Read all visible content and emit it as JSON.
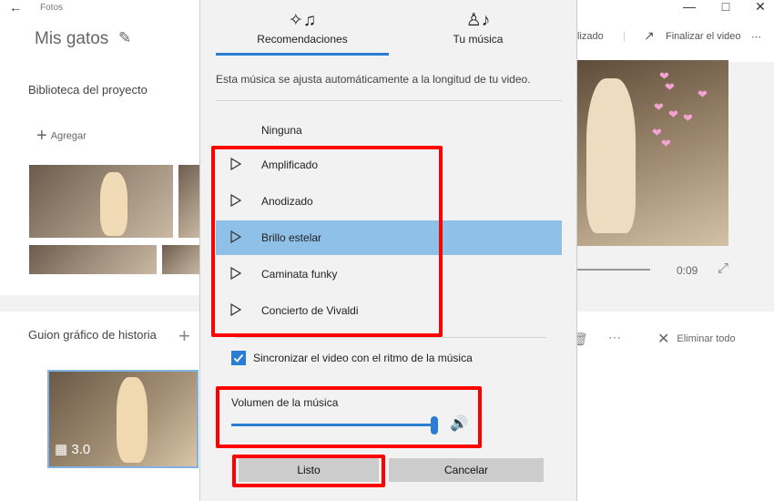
{
  "app": {
    "name": "Fotos",
    "project_title": "Mis gatos",
    "header_buttons": {
      "partial_label": "lizado",
      "finish_label": "Finalizar el video"
    }
  },
  "library": {
    "title": "Biblioteca del proyecto",
    "add_label": "Agregar"
  },
  "storyboard": {
    "title": "Guion gráfico de historia",
    "card_duration": "3.0",
    "remove_all_label": "Eliminar todo"
  },
  "preview": {
    "time": "0:09"
  },
  "dialog": {
    "tabs": [
      {
        "label": "Recomendaciones",
        "icon": "sparkle-music-icon",
        "active": true
      },
      {
        "label": "Tu música",
        "icon": "person-music-icon",
        "active": false
      }
    ],
    "description": "Esta música se ajusta automáticamente a la longitud de tu video.",
    "none_option": "Ninguna",
    "songs": [
      {
        "label": "Amplificado",
        "selected": false
      },
      {
        "label": "Anodizado",
        "selected": false
      },
      {
        "label": "Brillo estelar",
        "selected": true
      },
      {
        "label": "Caminata funky",
        "selected": false
      },
      {
        "label": "Concierto de Vivaldi",
        "selected": false
      }
    ],
    "sync_label": "Sincronizar el video con el ritmo de la música",
    "sync_checked": true,
    "volume_label": "Volumen de la música",
    "volume_level": 1.0,
    "done_label": "Listo",
    "cancel_label": "Cancelar"
  },
  "colors": {
    "accent": "#2b7cd3",
    "selected_row": "#8fc0e8",
    "highlight_box": "#ff0000"
  }
}
